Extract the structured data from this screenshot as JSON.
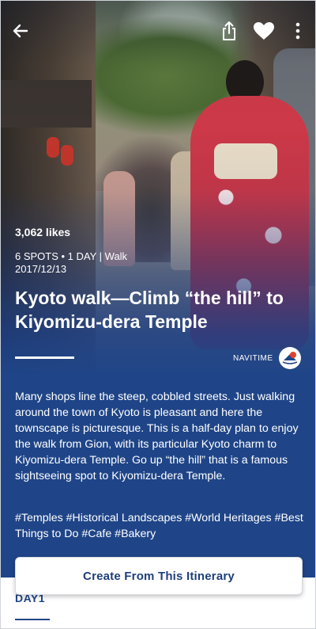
{
  "header": {
    "back_icon": "back-arrow-icon",
    "share_icon": "share-icon",
    "favorite_icon": "heart-icon",
    "more_icon": "more-vertical-icon"
  },
  "itinerary": {
    "likes": "3,062 likes",
    "meta": "6 SPOTS • 1 DAY | Walk",
    "date": "2017/12/13",
    "title": "Kyoto walk—Climb “the hill” to Kiyomizu-dera Temple",
    "brand": "NAVITIME",
    "description": "Many shops line the steep, cobbled streets. Just walking around the town of Kyoto is pleasant and here the townscape is picturesque. This is a half-day plan to enjoy the walk from Gion, with its particular Kyoto charm to Kiyomizu-dera Temple. Go up “the hill” that is a famous sightseeing spot to Kiyomizu-dera Temple.",
    "tags": "#Temples #Historical Landscapes #World Heritages #Best Things to Do #Cafe #Bakery"
  },
  "actions": {
    "create_label": "Create From This Itinerary"
  },
  "tabs": {
    "day1": "DAY1"
  },
  "colors": {
    "panel_blue": "#1f4588",
    "button_text": "#1f3f7a"
  }
}
